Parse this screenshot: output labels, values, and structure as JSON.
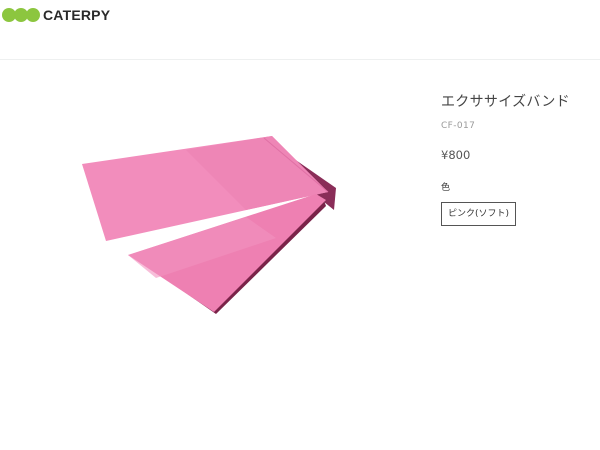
{
  "brand": {
    "name": "CATERPY",
    "logo_color": "#8cc63f"
  },
  "product": {
    "title": "エクササイズバンド",
    "code": "CF-017",
    "price": "¥800",
    "image_alt": "pink exercise band",
    "image_color": "#e885b2"
  },
  "options": {
    "color_label": "色",
    "variants": [
      {
        "label": "ピンク(ソフト)"
      }
    ]
  }
}
